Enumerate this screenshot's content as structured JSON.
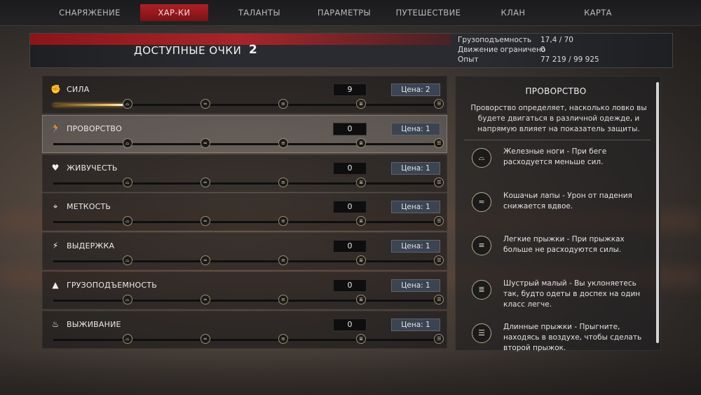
{
  "nav": {
    "tabs": [
      {
        "label": "СНАРЯЖЕНИЕ"
      },
      {
        "label": "ХАР-КИ",
        "active": true
      },
      {
        "label": "ТАЛАНТЫ"
      },
      {
        "label": "ПАРАМЕТРЫ"
      },
      {
        "label": "ПУТЕШЕСТВИЕ"
      },
      {
        "label": "КЛАН"
      },
      {
        "label": "КАРТА"
      }
    ]
  },
  "header": {
    "title": "ДОСТУПНЫЕ ОЧКИ",
    "points": "2",
    "info": [
      {
        "label": "Грузоподъемность",
        "value": "17,4 / 70"
      },
      {
        "label": "Движение ограничено",
        "value": "0"
      },
      {
        "label": "Опыт",
        "value": "77 219 / 99 925"
      }
    ]
  },
  "stats": [
    {
      "name": "СИЛА",
      "icon": "fist-icon",
      "glyph": "✊",
      "value": "9",
      "cost": "Цена: 2",
      "progress": 0.18
    },
    {
      "name": "ПРОВОРСТВО",
      "icon": "running-icon",
      "glyph": "🏃",
      "value": "0",
      "cost": "Цена: 1",
      "progress": 0,
      "selected": true
    },
    {
      "name": "ЖИВУЧЕСТЬ",
      "icon": "heart-icon",
      "glyph": "♥",
      "value": "0",
      "cost": "Цена: 1",
      "progress": 0
    },
    {
      "name": "МЕТКОСТЬ",
      "icon": "crosshair-icon",
      "glyph": "⌖",
      "value": "0",
      "cost": "Цена: 1",
      "progress": 0
    },
    {
      "name": "ВЫДЕРЖКА",
      "icon": "lightning-icon",
      "glyph": "⚡",
      "value": "0",
      "cost": "Цена: 1",
      "progress": 0
    },
    {
      "name": "ГРУЗОПОДЪЕМНОСТЬ",
      "icon": "weight-icon",
      "glyph": "▲",
      "value": "0",
      "cost": "Цена: 1",
      "progress": 0
    },
    {
      "name": "ВЫЖИВАНИЕ",
      "icon": "campfire-icon",
      "glyph": "♨",
      "value": "0",
      "cost": "Цена: 1",
      "progress": 0
    }
  ],
  "detail": {
    "title": "ПРОВОРСТВО",
    "description": "Проворство определяет, насколько ловко вы будете двигаться в различной одежде, и напрямую влияет на показатель защиты.",
    "perks": [
      {
        "text": "Железные ноги - При беге расходуется меньше сил.",
        "icon": "perk-tier1-icon",
        "glyph": "⌓"
      },
      {
        "text": "Кошачьи лапы - Урон от падения снижается вдвое.",
        "icon": "perk-tier2-icon",
        "glyph": "≂"
      },
      {
        "text": "Легкие прыжки - При прыжках больше не расходуются силы.",
        "icon": "perk-tier3-icon",
        "glyph": "≡"
      },
      {
        "text": "Шустрый малый - Вы уклоняетесь так, будто одеты в доспех на один класс легче.",
        "icon": "perk-tier4-icon",
        "glyph": "≣"
      },
      {
        "text": "Длинные прыжки - Прыгните, находясь в воздухе, чтобы сделать второй прыжок.",
        "icon": "perk-tier5-icon",
        "glyph": "☰"
      }
    ]
  },
  "colors": {
    "accent": "#b01f24",
    "gold": "#f2c86a",
    "cost_bg": "#3b4450"
  }
}
